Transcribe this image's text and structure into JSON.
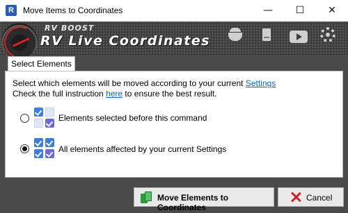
{
  "window": {
    "title": "Move Items to Coordinates",
    "app_icon_letter": "R",
    "minimize_glyph": "—",
    "maximize_glyph": "☐",
    "close_glyph": "✕"
  },
  "banner": {
    "brand_small": "RV BOOST",
    "brand_big": "RV Live Coordinates",
    "icons": [
      "chef-pot-icon",
      "book-icon",
      "video-play-icon",
      "gear-icon"
    ]
  },
  "tab": {
    "label": "Select Elements"
  },
  "instructions": {
    "line1_prefix": "Select which elements will be moved according to your current ",
    "line1_link": "Settings",
    "line2_prefix": "Check the full instruction ",
    "line2_link": "here",
    "line2_suffix": " to ensure the best result."
  },
  "options": [
    {
      "label": "Elements selected before this command",
      "selected": false
    },
    {
      "label": "All elements affected by your current Settings",
      "selected": true
    }
  ],
  "buttons": {
    "move_label": "Move Elements to Coordinates",
    "cancel_label": "Cancel"
  },
  "colors": {
    "accent_blue": "#3b7de0",
    "link": "#0b63c5",
    "cancel_x": "#d11f2a",
    "move_green": "#2e9b3e"
  }
}
